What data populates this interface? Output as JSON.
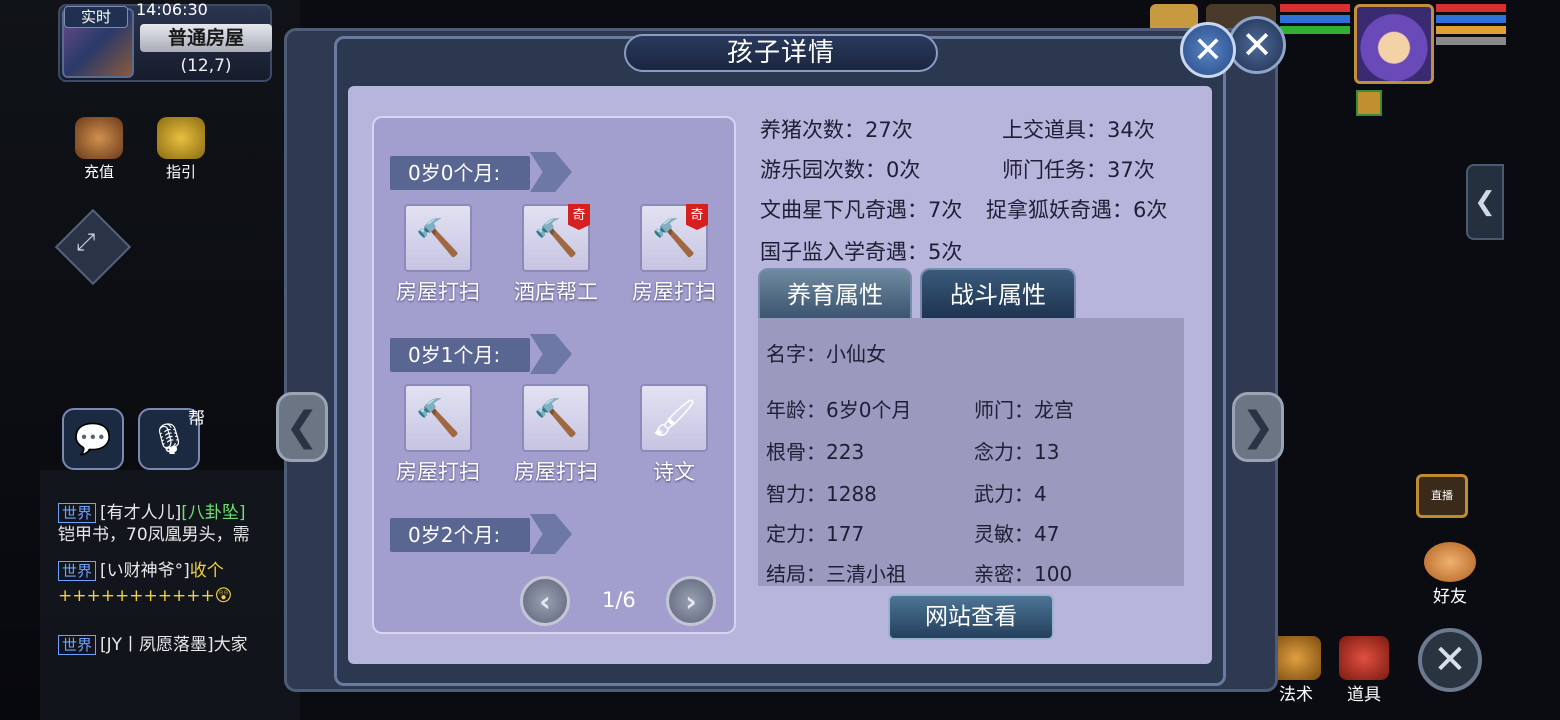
{
  "hud": {
    "realtime_tag": "实时",
    "clock": "14:06:30",
    "map_name": "普通房屋",
    "map_coords": "(12,7)",
    "buttons": [
      {
        "label": "充值",
        "icon": "treasure-chest-icon"
      },
      {
        "label": "指引",
        "icon": "scroll-hint-icon"
      }
    ],
    "guild_badge": "帮",
    "chat": [
      {
        "channel": "世界",
        "name": "[有才人儿]",
        "msg": "[八卦坠]",
        "line2": "铠甲书，70凤凰男头，需"
      },
      {
        "channel": "世界",
        "name": "[い财神爷°]",
        "msg": "收个",
        "line2": "+++++++++++😲"
      },
      {
        "channel": "世界",
        "name": "[JY丨夙愿落墨]",
        "msg": "大家"
      }
    ],
    "right": {
      "live_label": "直播",
      "friend_label": "好友",
      "magic_label": "法术",
      "items_label": "道具"
    }
  },
  "dialog": {
    "title": "孩子详情",
    "schedule": [
      {
        "month": "0岁0个月:",
        "jobs": [
          {
            "label": "房屋打扫",
            "icon": "hammer-icon",
            "special": false
          },
          {
            "label": "酒店帮工",
            "icon": "hammer-icon",
            "special": true
          },
          {
            "label": "房屋打扫",
            "icon": "hammer-icon",
            "special": true
          }
        ]
      },
      {
        "month": "0岁1个月:",
        "jobs": [
          {
            "label": "房屋打扫",
            "icon": "hammer-icon",
            "special": false
          },
          {
            "label": "房屋打扫",
            "icon": "hammer-icon",
            "special": false
          },
          {
            "label": "诗文",
            "icon": "brush-icon",
            "special": false
          }
        ]
      },
      {
        "month": "0岁2个月:",
        "jobs": []
      }
    ],
    "special_mark": "奇",
    "pager": "1/6",
    "stats": {
      "pig_raising": "养猪次数：27次",
      "items_submitted": "上交道具：34次",
      "amusement_park": "游乐园次数：0次",
      "school_tasks": "师门任务：37次",
      "wenqu_event": "文曲星下凡奇遇：7次",
      "fox_event": "捉拿狐妖奇遇：6次",
      "imperial_event": "国子监入学奇遇：5次"
    },
    "tabs": {
      "nurture": "养育属性",
      "combat": "战斗属性"
    },
    "attributes": {
      "name": "名字：小仙女",
      "age": "年龄：6岁0个月",
      "school": "师门：龙宫",
      "root": "根骨：223",
      "mind": "念力：13",
      "intel": "智力：1288",
      "force": "武力：4",
      "focus": "定力：177",
      "agility": "灵敏：47",
      "ending": "结局：三清小祖",
      "intimacy": "亲密：100"
    },
    "web_button": "网站查看"
  }
}
